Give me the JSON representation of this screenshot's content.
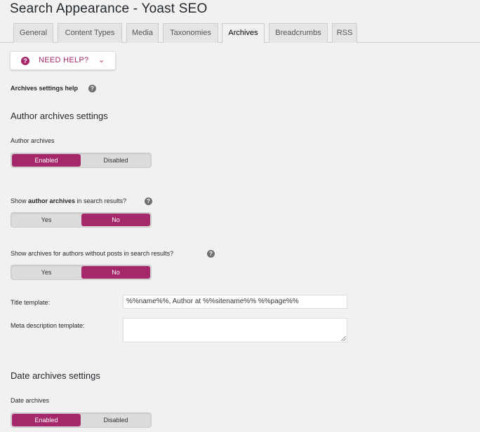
{
  "page": {
    "title": "Search Appearance - Yoast SEO"
  },
  "tabs": [
    {
      "label": "General"
    },
    {
      "label": "Content Types"
    },
    {
      "label": "Media"
    },
    {
      "label": "Taxonomies"
    },
    {
      "label": "Archives",
      "active": true
    },
    {
      "label": "Breadcrumbs"
    },
    {
      "label": "RSS"
    }
  ],
  "help_button": {
    "label": "NEED HELP?",
    "icon": "question-circle-icon",
    "chevron": "chevron-down-icon"
  },
  "archives_help": {
    "label": "Archives settings help"
  },
  "author_section": {
    "title": "Author archives settings",
    "author_archives": {
      "label": "Author archives",
      "options": [
        "Enabled",
        "Disabled"
      ],
      "selected": "Enabled"
    },
    "show_in_search": {
      "label_prefix": "Show ",
      "label_bold": "author archives",
      "label_suffix": " in search results?",
      "options": [
        "Yes",
        "No"
      ],
      "selected": "No"
    },
    "no_posts": {
      "label": "Show archives for authors without posts in search results?",
      "options": [
        "Yes",
        "No"
      ],
      "selected": "No"
    },
    "title_template": {
      "label": "Title template:",
      "value": "%%name%%, Author at %%sitename%% %%page%%"
    },
    "meta_template": {
      "label": "Meta description template:",
      "value": ""
    }
  },
  "date_section": {
    "title": "Date archives settings",
    "date_archives": {
      "label": "Date archives",
      "options": [
        "Enabled",
        "Disabled"
      ],
      "selected": "Enabled"
    }
  },
  "colors": {
    "accent": "#a4286a",
    "background": "#f1f1f1"
  }
}
